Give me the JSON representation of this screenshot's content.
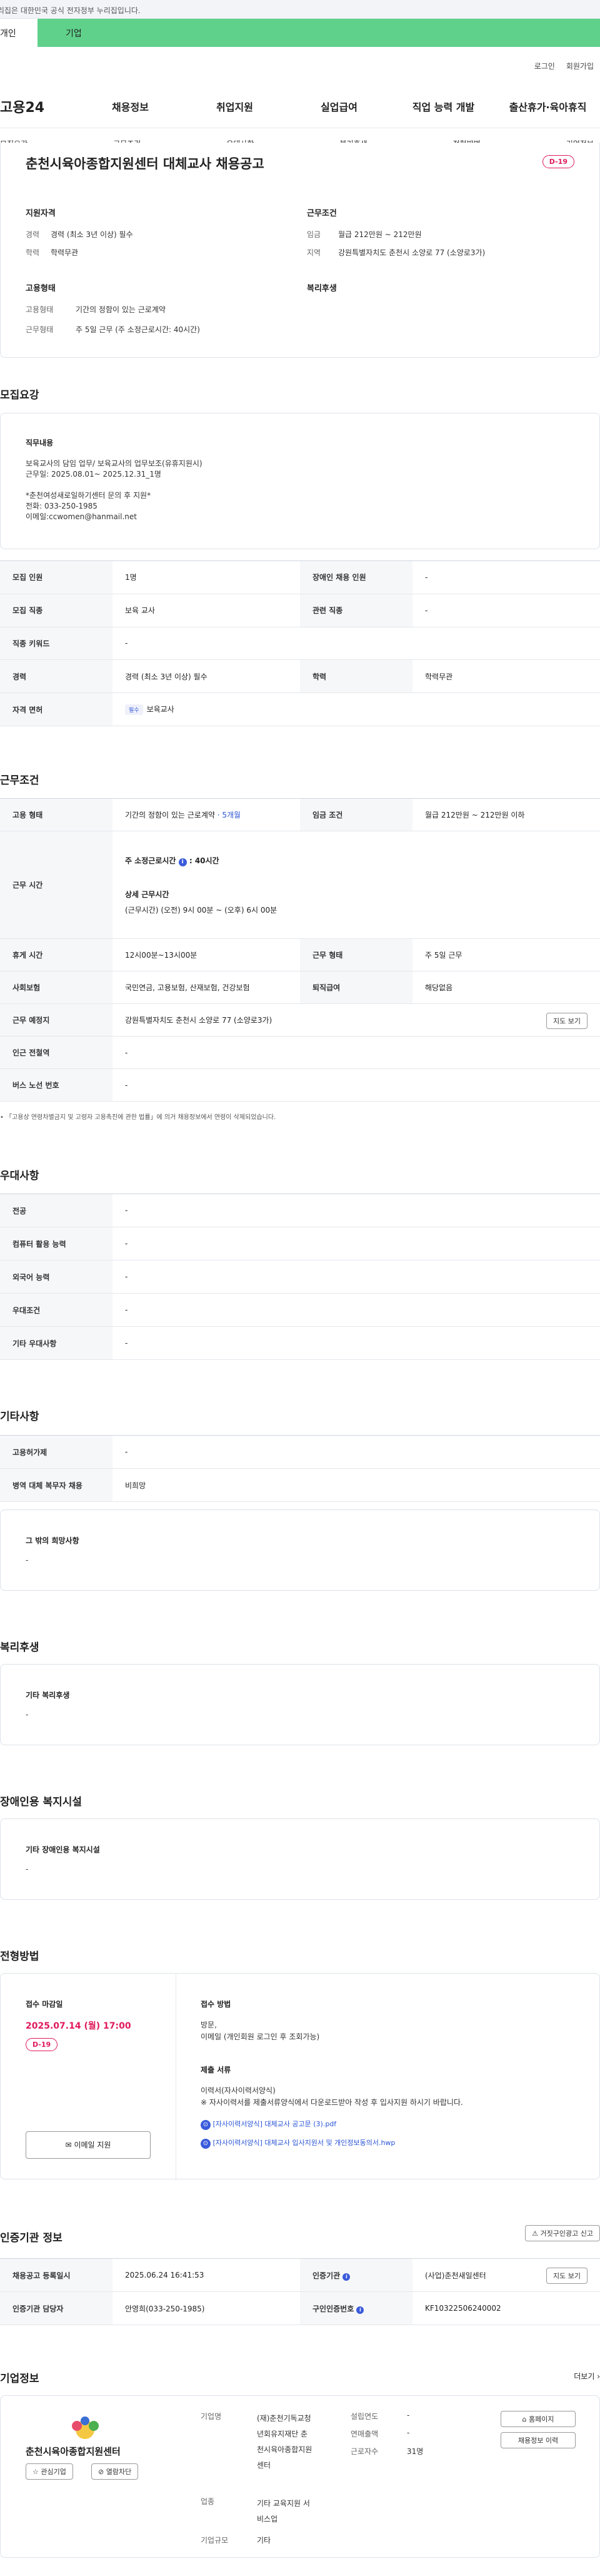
{
  "gov_banner": "이 누리집은 대한민국 공식 전자정부 누리집입니다.",
  "tabs": [
    "개인",
    "기업"
  ],
  "utils": [
    "로그인",
    "회원가입"
  ],
  "logo": "고용24",
  "menu": [
    "채용정보",
    "취업지원",
    "실업급여",
    "직업 능력 개발",
    "출산휴가·육아휴직"
  ],
  "anchors": [
    "모집요강",
    "근무조건",
    "우대사항",
    "복리후생",
    "전형방법",
    "기업정보"
  ],
  "job_title": "춘천시육아종합지원센터 대체교사 채용공고",
  "dday": "D-19",
  "summary": {
    "qual_title": "지원자격",
    "career_l": "경력",
    "career_v": "경력 (최소 3년 이상) 필수",
    "edu_l": "학력",
    "edu_v": "학력무관",
    "cond_title": "근무조건",
    "wage_l": "임금",
    "wage_v": "월급 212만원 ~ 212만원",
    "area_l": "지역",
    "area_v": "강원특별자치도 춘천시 소양로 77 (소양로3가)",
    "emp_title": "고용형태",
    "emptype_l": "고용형태",
    "emptype_v": "기간의 정함이 있는 근로계약",
    "worktype_l": "근무형태",
    "worktype_v": "주 5일 근무 (주 소정근로시간: 40시간)",
    "welfare_title": "복리후생"
  },
  "recruit": {
    "heading": "모집요강",
    "duty_title": "직무내용",
    "duty_lines": [
      "보육교사의 담임 업무/ 보육교사의 업무보조(유휴지원시)",
      "근무일: 2025.08.01~ 2025.12.31_1명",
      "",
      "*춘천여성새로일하기센터 문의 후 지원*",
      "전화: 033-250-1985",
      "이메일:ccwomen@hanmail.net"
    ],
    "rows": [
      {
        "l1": "모집 인원",
        "v1": "1명",
        "l2": "장애인 채용 인원",
        "v2": "-"
      },
      {
        "l1": "모집 직종",
        "v1": "보육 교사",
        "l2": "관련 직종",
        "v2": "-"
      },
      {
        "l1": "직종 키워드",
        "v1": "-"
      },
      {
        "l1": "경력",
        "v1": "경력 (최소 3년 이상) 필수",
        "l2": "학력",
        "v2": "학력무관"
      },
      {
        "l1": "자격 면허",
        "v1": "보육교사",
        "pill": "필수"
      }
    ]
  },
  "work": {
    "heading": "근무조건",
    "emp_l": "고용 형태",
    "emp_v": "기간의 정함이 있는 근로계약",
    "emp_m": " · 5개월",
    "wage_l": "임금 조건",
    "wage_v": "월급 212만원 ~ 212만원 이하",
    "time_l": "근무 시간",
    "weekly": "주 소정근로시간",
    "weekly_v": "40시간",
    "detail_t": "상세 근무시간",
    "detail_v": "(근무시간) (오전) 9시 00분 ~ (오후) 6시 00분",
    "break_l": "휴게 시간",
    "break_v": "12시00분~13시00분",
    "form_l": "근무 형태",
    "form_v": "주 5일 근무",
    "ins_l": "사회보험",
    "ins_v": "국민연금, 고용보험, 산재보험, 건강보험",
    "sev_l": "퇴직급여",
    "sev_v": "해당없음",
    "place_l": "근무 예정지",
    "place_v": "강원특별자치도 춘천시 소양로 77 (소양로3가)",
    "map_btn": "지도 보기",
    "sub_l": "인근 전철역",
    "sub_v": "-",
    "bus_l": "버스 노선 번호",
    "bus_v": "-",
    "note": "「고용상 연령차별금지 및 고령자 고용촉진에 관한 법률」에 의거 채용정보에서 연령이 삭제되었습니다."
  },
  "pref": {
    "heading": "우대사항",
    "rows": [
      {
        "l": "전공",
        "v": "-"
      },
      {
        "l": "컴퓨터 활용 능력",
        "v": "-"
      },
      {
        "l": "외국어 능력",
        "v": "-"
      },
      {
        "l": "우대조건",
        "v": "-"
      },
      {
        "l": "기타 우대사항",
        "v": "-"
      }
    ]
  },
  "etc": {
    "heading": "기타사항",
    "rows": [
      {
        "l": "고용허가제",
        "v": "-"
      },
      {
        "l": "병역 대체 복무자 채용",
        "v": "비희망"
      }
    ],
    "box_t": "그 밖의 희망사항",
    "box_v": "-"
  },
  "welfare": {
    "heading": "복리후생",
    "box_t": "기타 복리후생",
    "box_v": "-"
  },
  "disab": {
    "heading": "장애인용 복지시설",
    "box_t": "기타 장애인용 복지시설",
    "box_v": "-"
  },
  "process": {
    "heading": "전형방법",
    "deadline_t": "접수 마감일",
    "deadline_v": "2025.07.14 (월) 17:00",
    "dday": "D-19",
    "email_btn": "이메일 지원",
    "method_t": "접수 방법",
    "method_v1": "방문,",
    "method_v2": "이메일 (개인회원 로그인 후 조회가능)",
    "docs_t": "제출 서류",
    "docs_v1": "이력서(자사이력서양식)",
    "docs_v2": "※ 자사이력서를 제출서류양식에서 다운로드받아 작성 후 입사지원 하시기 바랍니다.",
    "file1": "[자사이력서양식] 대체교사 공고문 (3).pdf",
    "file2": "[자사이력서양식] 대체교사 입사지원서 및 개인정보동의서.hwp"
  },
  "cert": {
    "heading": "인증기관 정보",
    "report_btn": "거짓구인광고 신고",
    "reg_l": "채용공고 등록일시",
    "reg_v": "2025.06.24 16:41:53",
    "org_l": "인증기관",
    "org_v": "(사업)춘천새일센터",
    "map_btn": "지도 보기",
    "mgr_l": "인증기관 담당자",
    "mgr_v": "안영희(033-250-1985)",
    "no_l": "구인인증번호",
    "no_v": "KF10322506240002"
  },
  "company": {
    "heading": "기업정보",
    "more": "더보기",
    "name": "춘천시육아종합지원센터",
    "fav_btn": "관심기업",
    "block_btn": "열람차단",
    "corp_l": "기업명",
    "corp_v": [
      "(재)춘천기독교청",
      "년회유지재단 춘",
      "천시육아종합지원",
      "센터"
    ],
    "year_l": "설립연도",
    "year_v": "-",
    "sales_l": "연매출액",
    "sales_v": "-",
    "staff_l": "근로자수",
    "staff_v": "31명",
    "ind_l": "업종",
    "ind_v": [
      "기타 교육지원 서",
      "비스업"
    ],
    "size_l": "기업규모",
    "size_v": "기타",
    "home_btn": "홈페이지",
    "jobinfo_btn": "채용정보 이력"
  },
  "colors": {
    "accent": "#e01a5b",
    "green": "#5fd18a",
    "blue": "#2b54d6"
  }
}
